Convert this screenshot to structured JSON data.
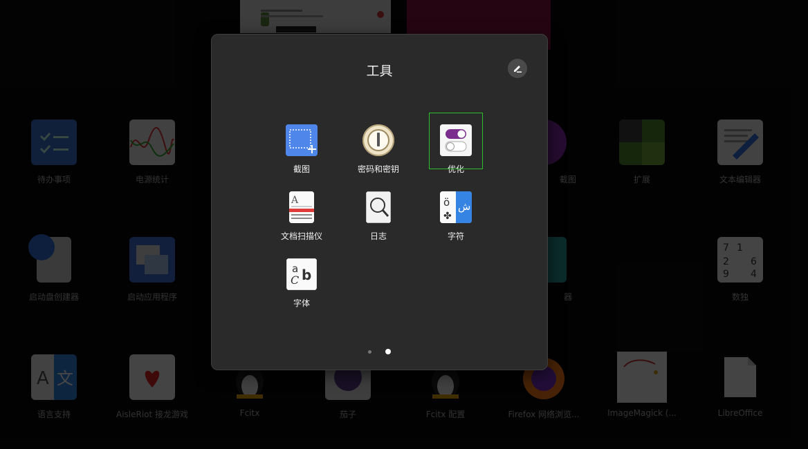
{
  "folder": {
    "title": "工具",
    "edit_icon": "pencil-icon",
    "apps": [
      {
        "label": "截图",
        "icon": "screenshot-icon"
      },
      {
        "label": "密码和密钥",
        "icon": "keyring-icon"
      },
      {
        "label": "优化",
        "icon": "toggle-switches-icon"
      },
      {
        "label": "文档扫描仪",
        "icon": "scanner-icon"
      },
      {
        "label": "日志",
        "icon": "magnifier-icon"
      },
      {
        "label": "字符",
        "icon": "characters-icon"
      },
      {
        "label": "字体",
        "icon": "fonts-icon"
      }
    ],
    "pages": 2,
    "current_page": 2
  },
  "background": {
    "row1": [
      "待办事项",
      "电源统计",
      "截图",
      "扩展",
      "文本编辑器"
    ],
    "row2": [
      "启动盘创建器",
      "启动应用程序",
      "器",
      "数独"
    ],
    "row3": [
      "语言支持",
      "AisleRiot 接龙游戏",
      "Fcitx",
      "茄子",
      "Fcitx 配置",
      "Firefox 网络浏览...",
      "ImageMagick (...",
      "LibreOffice"
    ]
  },
  "colors": {
    "folder_bg": "#2a2a2a",
    "selection_outline": "#2dbf2d",
    "toggle_purple": "#7b2d8e",
    "characters_blue": "#3584e4"
  }
}
